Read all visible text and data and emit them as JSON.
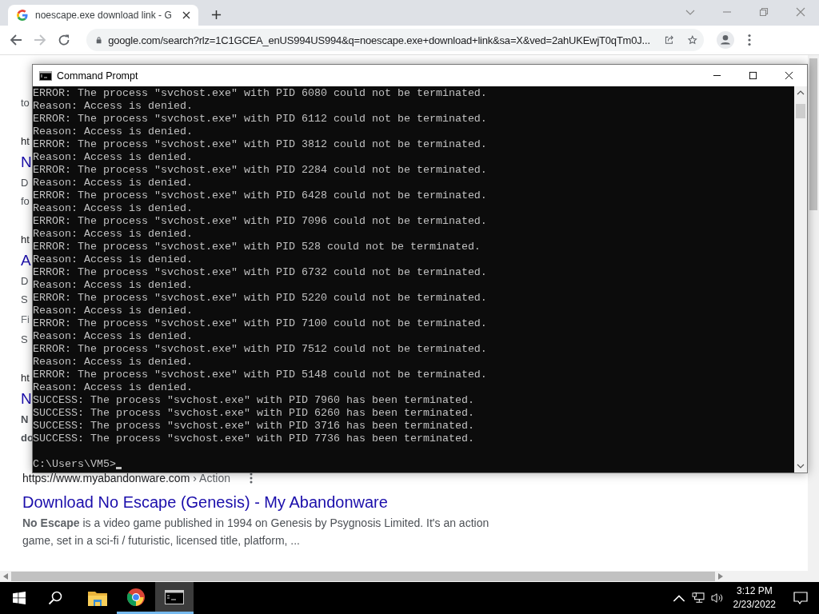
{
  "browser": {
    "tab_title": "noescape.exe download link - G",
    "url": "google.com/search?rlz=1C1GCEA_enUS994US994&q=noescape.exe+download+link&sa=X&ved=2ahUKEwjT0qTm0J..."
  },
  "page": {
    "fragments": [
      [
        {
          "kind": "snippet",
          "text": "to"
        }
      ],
      [
        {
          "kind": "url",
          "text": "ht"
        },
        {
          "kind": "title",
          "text": "N"
        },
        {
          "kind": "snippet",
          "text": "D"
        },
        {
          "kind": "snippet",
          "text": "fo"
        }
      ],
      [
        {
          "kind": "url",
          "text": "ht"
        },
        {
          "kind": "title",
          "text": "A"
        },
        {
          "kind": "snippet",
          "text": "D"
        },
        {
          "kind": "snippet",
          "text": "S"
        },
        {
          "kind": "sitelink",
          "text": "Fi"
        },
        {
          "kind": "snippet",
          "text": "S"
        }
      ],
      [
        {
          "kind": "url",
          "text": "ht"
        },
        {
          "kind": "title",
          "text": "N"
        },
        {
          "kind": "bold",
          "text": "N"
        },
        {
          "kind": "bold",
          "text": "do"
        }
      ]
    ],
    "result": {
      "url": "https://www.myabandonware.com",
      "breadcrumb": "› Action",
      "title": "Download No Escape (Genesis) - My Abandonware",
      "snippet": "**No Escape** is a video game published in 1994 on Genesis by Psygnosis Limited. It's an action game, set in a sci-fi / futuristic, licensed title, platform, ..."
    }
  },
  "cmd": {
    "title": "Command Prompt",
    "lines": [
      "ERROR: The process \"svchost.exe\" with PID 6080 could not be terminated.",
      "Reason: Access is denied.",
      "ERROR: The process \"svchost.exe\" with PID 6112 could not be terminated.",
      "Reason: Access is denied.",
      "ERROR: The process \"svchost.exe\" with PID 3812 could not be terminated.",
      "Reason: Access is denied.",
      "ERROR: The process \"svchost.exe\" with PID 2284 could not be terminated.",
      "Reason: Access is denied.",
      "ERROR: The process \"svchost.exe\" with PID 6428 could not be terminated.",
      "Reason: Access is denied.",
      "ERROR: The process \"svchost.exe\" with PID 7096 could not be terminated.",
      "Reason: Access is denied.",
      "ERROR: The process \"svchost.exe\" with PID 528 could not be terminated.",
      "Reason: Access is denied.",
      "ERROR: The process \"svchost.exe\" with PID 6732 could not be terminated.",
      "Reason: Access is denied.",
      "ERROR: The process \"svchost.exe\" with PID 5220 could not be terminated.",
      "Reason: Access is denied.",
      "ERROR: The process \"svchost.exe\" with PID 7100 could not be terminated.",
      "Reason: Access is denied.",
      "ERROR: The process \"svchost.exe\" with PID 7512 could not be terminated.",
      "Reason: Access is denied.",
      "ERROR: The process \"svchost.exe\" with PID 5148 could not be terminated.",
      "Reason: Access is denied.",
      "SUCCESS: The process \"svchost.exe\" with PID 7960 has been terminated.",
      "SUCCESS: The process \"svchost.exe\" with PID 6260 has been terminated.",
      "SUCCESS: The process \"svchost.exe\" with PID 3716 has been terminated.",
      "SUCCESS: The process \"svchost.exe\" with PID 7736 has been terminated."
    ],
    "prompt": "C:\\Users\\VM5>"
  },
  "taskbar": {
    "apps": [
      {
        "kind": "explorer",
        "running": false,
        "selected": false
      },
      {
        "kind": "chrome",
        "running": true,
        "selected": false
      },
      {
        "kind": "cmd",
        "running": true,
        "selected": true
      }
    ],
    "time": "3:12 PM",
    "date": "2/23/2022"
  }
}
